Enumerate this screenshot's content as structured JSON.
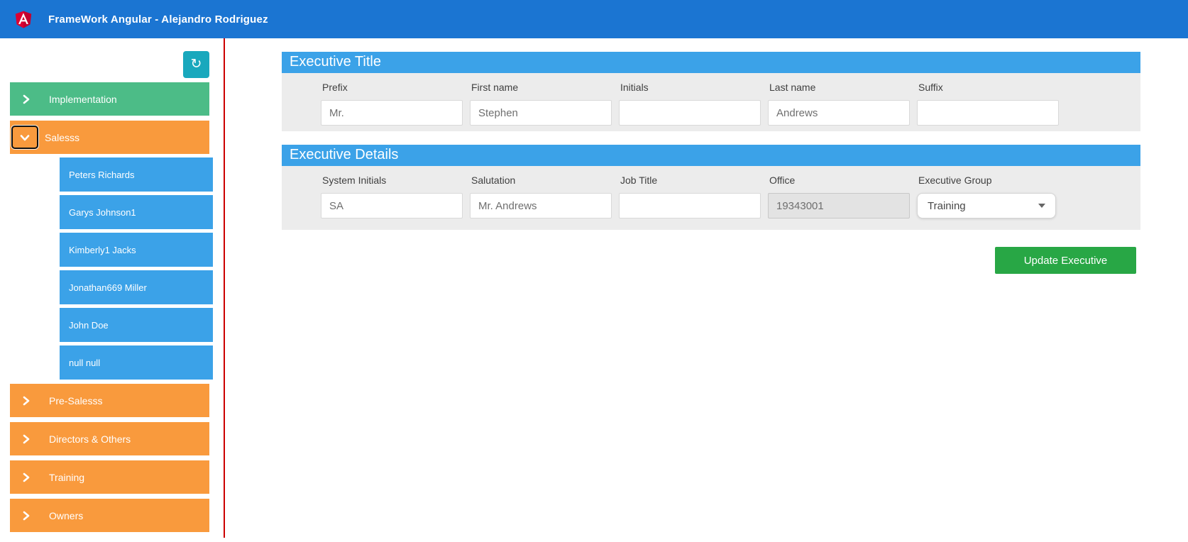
{
  "header": {
    "title": "FrameWork Angular - Alejandro Rodriguez"
  },
  "sidebar": {
    "refresh_glyph": "↻",
    "groups": [
      {
        "label": "Implementation",
        "state": "collapsed"
      },
      {
        "label": "Salesss",
        "state": "expanded"
      },
      {
        "label": "Pre-Salesss",
        "state": "collapsed"
      },
      {
        "label": "Directors & Others",
        "state": "collapsed"
      },
      {
        "label": "Training",
        "state": "collapsed"
      },
      {
        "label": "Owners",
        "state": "collapsed"
      }
    ],
    "sales_children": [
      {
        "name": "Peters Richards"
      },
      {
        "name": "Garys Johnson1"
      },
      {
        "name": "Kimberly1 Jacks"
      },
      {
        "name": "Jonathan669 Miller"
      },
      {
        "name": "John Doe"
      },
      {
        "name": "null null"
      }
    ]
  },
  "executive_title": {
    "heading": "Executive Title",
    "fields": [
      {
        "label": "Prefix",
        "value": "Mr."
      },
      {
        "label": "First name",
        "value": "Stephen"
      },
      {
        "label": "Initials",
        "value": ""
      },
      {
        "label": "Last name",
        "value": "Andrews"
      },
      {
        "label": "Suffix",
        "value": ""
      }
    ]
  },
  "executive_details": {
    "heading": "Executive Details",
    "fields": [
      {
        "label": "System Initials",
        "value": "SA"
      },
      {
        "label": "Salutation",
        "value": "Mr. Andrews"
      },
      {
        "label": "Job Title",
        "value": ""
      },
      {
        "label": "Office",
        "value": "19343001",
        "disabled": true
      },
      {
        "label": "Executive Group",
        "value": "Training",
        "type": "dropdown"
      }
    ]
  },
  "actions": {
    "update_button": "Update Executive"
  },
  "colors": {
    "header_blue": "#1b75d2",
    "section_blue": "#3ba2e8",
    "group_green": "#4cbc87",
    "group_orange": "#f99a3d",
    "refresh_teal": "#19a8bd",
    "button_green": "#28a745",
    "divider_red": "#cc0000",
    "logo_red": "#dd0031"
  }
}
